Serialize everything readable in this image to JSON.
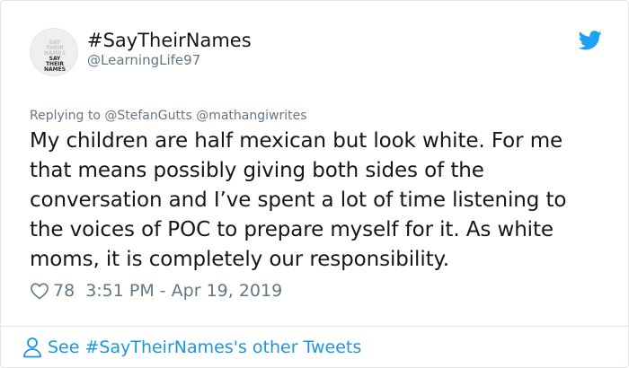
{
  "author": {
    "display_name": "#SayTheirNames",
    "handle": "@LearningLife97",
    "avatar_text": [
      "SAY",
      "THEIR",
      "NAMES",
      "SAY",
      "THEIR",
      "NAMES"
    ]
  },
  "reply": {
    "prefix": "Replying to",
    "mentions": [
      "@StefanGutts",
      "@mathangiwrites"
    ]
  },
  "tweet": {
    "text": "My children are half mexican but look white. For me that means possibly giving both sides of the conversation and I’ve spent a lot of time listening to the voices of POC to prepare myself for it. As white moms, it is completely our responsibility."
  },
  "meta": {
    "like_count": "78",
    "timestamp": "3:51 PM - Apr 19, 2019"
  },
  "footer": {
    "link_label": "See #SayTheirNames's other Tweets"
  },
  "icons": {
    "brand": "twitter-bird-icon",
    "like": "heart-icon",
    "profile": "person-icon"
  },
  "colors": {
    "twitter_blue": "#1da1f2",
    "link_blue": "#1b95e0",
    "muted_gray": "#657786",
    "text_dark": "#14171a",
    "border": "#e1e8ed"
  }
}
